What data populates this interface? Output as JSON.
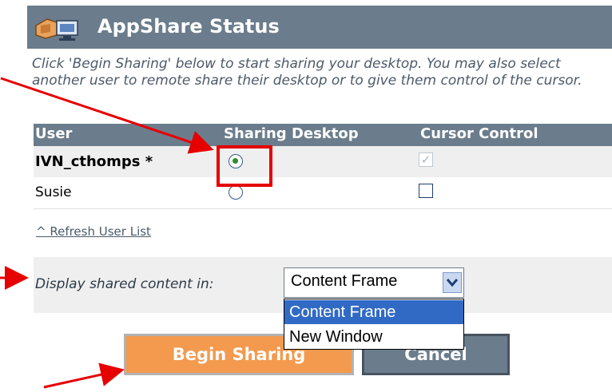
{
  "title": "AppShare Status",
  "intro": "Click 'Begin Sharing' below to start sharing your desktop. You may also select another user to remote share their desktop or to give them control of the cursor.",
  "table": {
    "headers": [
      "User",
      "Sharing Desktop",
      "Cursor Control"
    ],
    "rows": [
      {
        "user": "IVN_cthomps *",
        "sharing_selected": true,
        "cursor_control": true,
        "cursor_disabled": true
      },
      {
        "user": "Susie",
        "sharing_selected": false,
        "cursor_control": false,
        "cursor_disabled": false
      }
    ]
  },
  "refresh_link": "^ Refresh User List",
  "display": {
    "label": "Display shared content in:",
    "selected": "Content Frame",
    "options": [
      "Content Frame",
      "New Window"
    ]
  },
  "buttons": {
    "begin": "Begin Sharing",
    "cancel": "Cancel"
  },
  "colors": {
    "header": "#6b7d8c",
    "begin_button": "#f39a4e",
    "annotation": "#e60000",
    "selection": "#316ac5"
  }
}
